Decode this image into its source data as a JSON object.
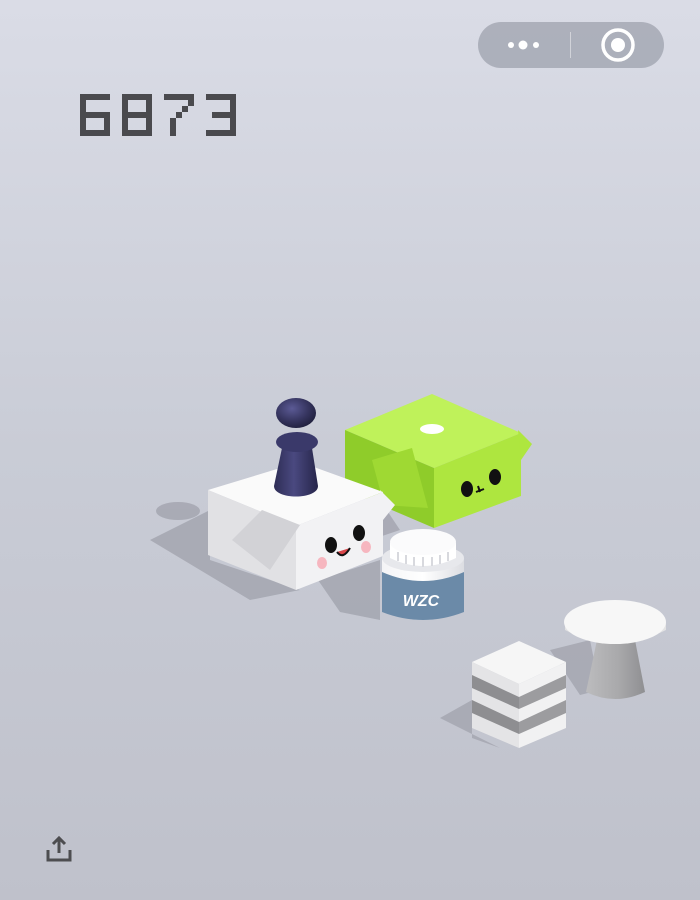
{
  "game": {
    "score": "6873"
  },
  "capsule": {
    "more_icon": "more-dots-icon",
    "close_icon": "target-circle-icon"
  },
  "share": {
    "icon": "share-upload-icon"
  },
  "scene": {
    "jar_label": "WZC"
  },
  "colors": {
    "background": "#d6d8e2",
    "score_digits": "#4a4a4e",
    "player_piece": "#3b3a6b",
    "green_box": "#b5eb48",
    "white_box": "#f2f2f2",
    "jar_label_band": "#6b8aa8",
    "capsule": "#a5a8b4"
  }
}
